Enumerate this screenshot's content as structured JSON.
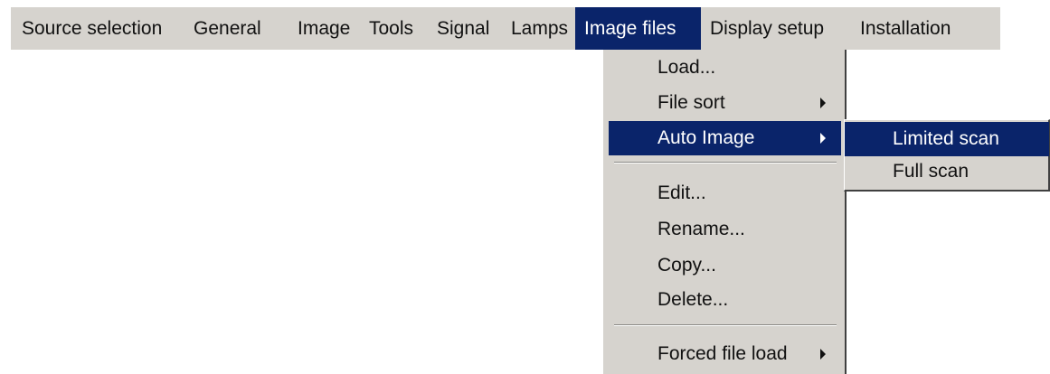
{
  "menubar": {
    "items": [
      {
        "label": "Source selection"
      },
      {
        "label": "General"
      },
      {
        "label": "Image"
      },
      {
        "label": "Tools"
      },
      {
        "label": "Signal"
      },
      {
        "label": "Lamps"
      },
      {
        "label": "Image files"
      },
      {
        "label": "Display setup"
      },
      {
        "label": "Installation"
      }
    ],
    "active": "Image files"
  },
  "dropdown": {
    "items": [
      {
        "label": "Load..."
      },
      {
        "label": "File sort"
      },
      {
        "label": "Auto Image"
      },
      {
        "label": "Edit..."
      },
      {
        "label": "Rename..."
      },
      {
        "label": "Copy..."
      },
      {
        "label": "Delete..."
      },
      {
        "label": "Forced file load"
      }
    ],
    "active": "Auto Image"
  },
  "submenu": {
    "items": [
      {
        "label": "Limited scan"
      },
      {
        "label": "Full scan"
      }
    ],
    "active": "Limited scan"
  },
  "colors": {
    "menu_background": "#d6d3ce",
    "highlight": "#0a246a",
    "highlight_text": "#ffffff"
  }
}
